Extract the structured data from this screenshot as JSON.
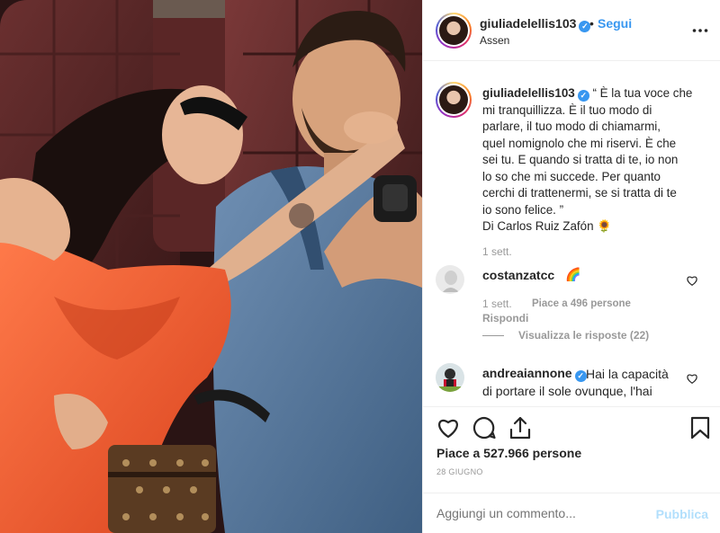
{
  "post": {
    "username": "giuliadelellis103",
    "follow_label": "Segui",
    "separator": "•",
    "location": "Assen",
    "verified_mark": "✓"
  },
  "caption": {
    "username": "giuliadelellis103",
    "lines": [
      "“ È la tua voce che",
      "mi tranquillizza. È il tuo modo di",
      "parlare, il tuo modo di chiamarmi,",
      "quel nomignolo che mi riservi. È che",
      "sei tu. E quando si tratta di te, io non",
      "lo so che mi succede. Per quanto",
      "cerchi di trattenermi, se si tratta di te",
      "io sono felice. ”",
      "Di Carlos Ruiz Zafón 🌻"
    ],
    "time": "1 sett."
  },
  "comments": [
    {
      "username": "costanzatcc",
      "text": "🌈",
      "time": "1 sett.",
      "likes": "Piace a 496 persone",
      "reply": "Rispondi",
      "view_replies": "Visualizza le risposte (22)"
    },
    {
      "username": "andreaiannone",
      "text_line1": "Hai la capacità",
      "text_line2": "di portare il sole ovunque, l'hai"
    }
  ],
  "likes_text": "Piace a 527.966 persone",
  "date": "28 GIUGNO",
  "add_comment": {
    "placeholder": "Aggiungi un commento...",
    "publish": "Pubblica"
  },
  "colors": {
    "accent": "#3897f0",
    "publish_disabled": "#b2dffc",
    "meta": "#999999"
  },
  "icons": [
    "more-icon",
    "heart-icon",
    "comment-icon",
    "share-icon",
    "bookmark-icon",
    "verified-icon"
  ]
}
